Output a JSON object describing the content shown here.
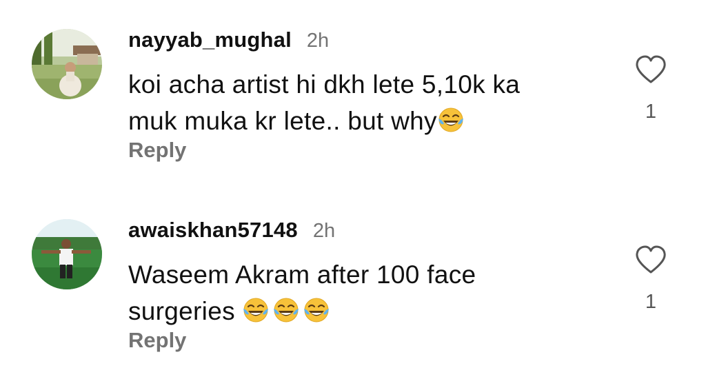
{
  "comments": [
    {
      "username": "nayyab_mughal",
      "time": "2h",
      "text_line1": "koi acha artist hi dkh lete 5,10k ka",
      "text_line2": "muk muka kr lete.. but why",
      "emojis": [
        "face-with-tears-of-joy"
      ],
      "reply_label": "Reply",
      "like_count": "1",
      "avatar": "outdoor-photo-woman-sitting-on-grass"
    },
    {
      "username": "awaiskhan57148",
      "time": "2h",
      "text_line1": "Waseem Akram after 100 face",
      "text_line2": "surgeries",
      "emojis": [
        "face-with-tears-of-joy",
        "face-with-tears-of-joy",
        "face-with-tears-of-joy"
      ],
      "reply_label": "Reply",
      "like_count": "1",
      "avatar": "outdoor-photo-man-arms-outstretched"
    }
  ],
  "colors": {
    "text": "#111111",
    "muted": "#737373",
    "background": "#ffffff"
  },
  "icons": {
    "like": "heart-outline-icon",
    "emoji": "face-with-tears-of-joy"
  }
}
